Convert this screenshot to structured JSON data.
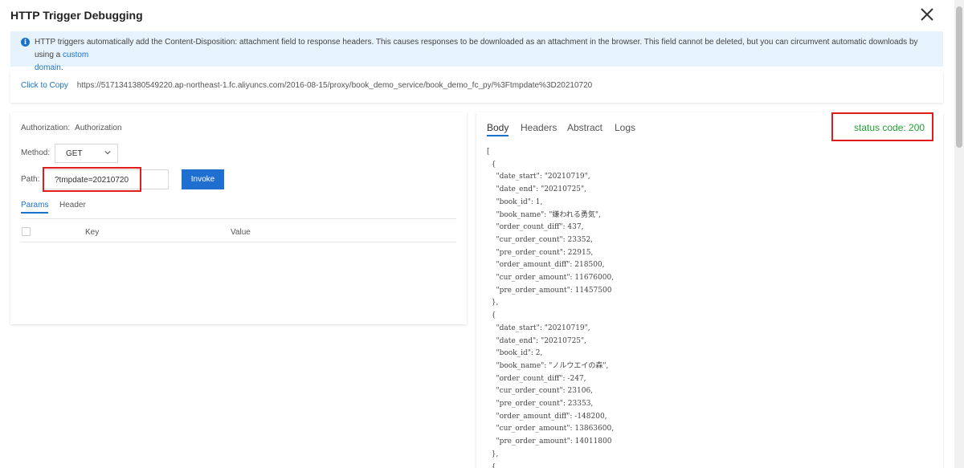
{
  "dialog": {
    "title": "HTTP Trigger Debugging"
  },
  "info": {
    "icon": "info-icon",
    "text": "HTTP triggers automatically add the Content-Disposition: attachment field to response headers. This causes responses to be downloaded as an attachment in the browser. This field cannot be deleted, but you can circumvent automatic downloads by using a ",
    "link_line1": "custom",
    "link_line2": "domain",
    "trailing": "."
  },
  "url_bar": {
    "copy_label": "Click to Copy",
    "url": "https://5171341380549220.ap-northeast-1.fc.aliyuncs.com/2016-08-15/proxy/book_demo_service/book_demo_fc_py/%3Ftmpdate%3D20210720"
  },
  "request": {
    "auth_label": "Authorization:",
    "auth_value": "Authorization",
    "method_label": "Method:",
    "method_value": "GET",
    "path_label": "Path:",
    "path_value": "?tmpdate=20210720",
    "invoke_label": "Invoke",
    "tabs": {
      "params": "Params",
      "header": "Header"
    },
    "columns": {
      "key": "Key",
      "value": "Value"
    }
  },
  "response": {
    "tabs": [
      "Body",
      "Headers",
      "Abstract",
      "Logs"
    ],
    "status": "status code: 200",
    "body_lines": [
      "[",
      "  {",
      "    \"date_start\": \"20210719\",",
      "    \"date_end\": \"20210725\",",
      "    \"book_id\": 1,",
      "    \"book_name\": \"嫌われる勇気\",",
      "    \"order_count_diff\": 437,",
      "    \"cur_order_count\": 23352,",
      "    \"pre_order_count\": 22915,",
      "    \"order_amount_diff\": 218500,",
      "    \"cur_order_amount\": 11676000,",
      "    \"pre_order_amount\": 11457500",
      "  },",
      "  {",
      "    \"date_start\": \"20210719\",",
      "    \"date_end\": \"20210725\",",
      "    \"book_id\": 2,",
      "    \"book_name\": \"ノルウエイの森\",",
      "    \"order_count_diff\": -247,",
      "    \"cur_order_count\": 23106,",
      "    \"pre_order_count\": 23353,",
      "    \"order_amount_diff\": -148200,",
      "    \"cur_order_amount\": 13863600,",
      "    \"pre_order_amount\": 14011800",
      "  },",
      "  {"
    ]
  },
  "colors": {
    "accent": "#1a73c9",
    "highlight": "#e21b1b",
    "status": "#22a133",
    "info_bg": "#e6f3fc"
  }
}
